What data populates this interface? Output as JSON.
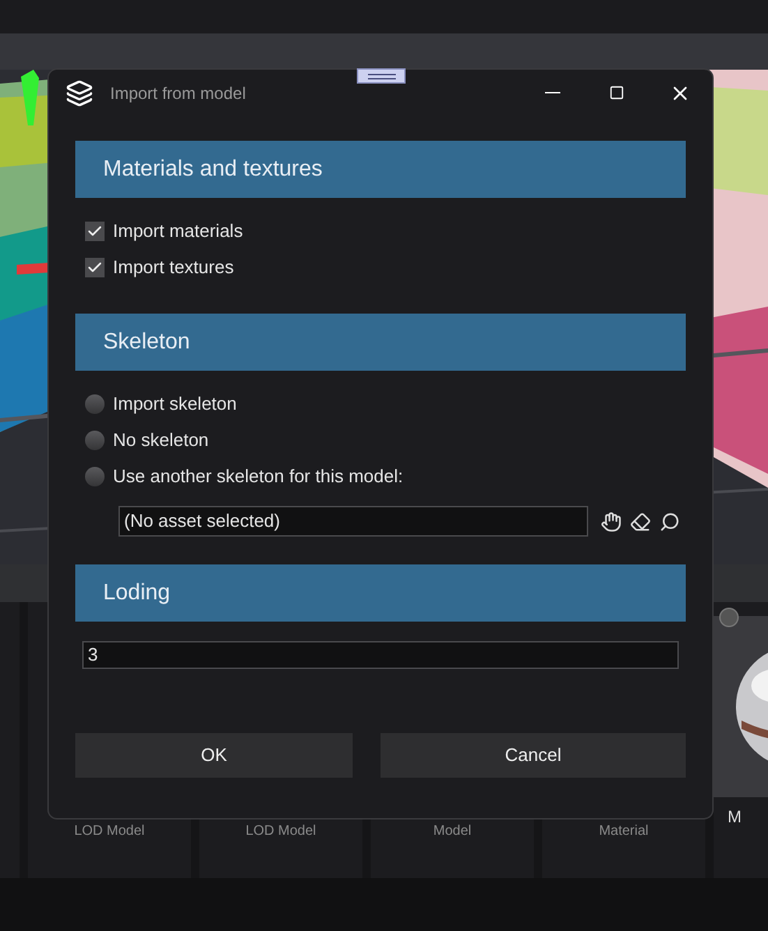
{
  "window": {
    "title": "Import from model"
  },
  "sections": [
    {
      "title": "Materials and textures",
      "items": [
        {
          "kind": "checkbox",
          "label": "Import materials",
          "checked": true
        },
        {
          "kind": "checkbox",
          "label": "Import textures",
          "checked": true
        }
      ]
    },
    {
      "title": "Skeleton",
      "items": [
        {
          "kind": "radio",
          "label": "Import skeleton",
          "selected": false
        },
        {
          "kind": "radio",
          "label": "No skeleton",
          "selected": false
        },
        {
          "kind": "radio",
          "label": "Use another skeleton for this model:",
          "selected": false
        },
        {
          "kind": "asset_field",
          "value": "(No asset selected)"
        }
      ]
    },
    {
      "title": "Loding",
      "items": [
        {
          "kind": "text_field",
          "value": "3"
        }
      ]
    }
  ],
  "buttons": [
    "OK",
    "Cancel"
  ],
  "background_assets": [
    {
      "label": "LOD Model"
    },
    {
      "label": "LOD Model"
    },
    {
      "label": "Model"
    },
    {
      "label": "Material"
    },
    {
      "label": "M",
      "kind": "picture"
    }
  ]
}
